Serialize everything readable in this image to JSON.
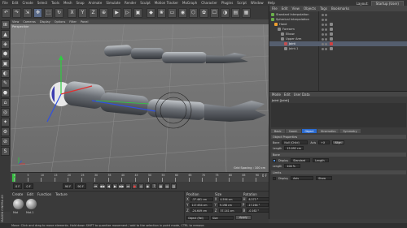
{
  "menubar": {
    "items": [
      "File",
      "Edit",
      "Create",
      "Select",
      "Tools",
      "Mesh",
      "Snap",
      "Animate",
      "Simulate",
      "Render",
      "Sculpt",
      "Motion Tracker",
      "MoGraph",
      "Character",
      "Plugins",
      "Script",
      "Window",
      "Help"
    ],
    "layout_label": "Layout:",
    "layout_value": "Startup (User)"
  },
  "toolbar": {
    "buttons": [
      "↶",
      "↷",
      "⇲",
      "✥",
      "⬚",
      "↻",
      "X",
      "Y",
      "Z",
      "⊕",
      "▶",
      "▷",
      "▣",
      "◆",
      "❀",
      "▭",
      "◉",
      "⬡",
      "✿",
      "☐",
      "◑",
      "▤",
      "▦"
    ]
  },
  "lefttoolbar": {
    "buttons": [
      "⊞",
      "▲",
      "◈",
      "⬢",
      "▣",
      "◐",
      "✎",
      "⬣",
      "⌂",
      "◎",
      "✦",
      "⚙",
      "⊘",
      "S"
    ]
  },
  "viewport": {
    "menu": [
      "View",
      "Cameras",
      "Display",
      "Options",
      "Filter",
      "Panel"
    ],
    "label": "Perspective",
    "grid_spacing": "Grid Spacing : 100 cm"
  },
  "timeline": {
    "ticks": [
      "0",
      "5",
      "10",
      "15",
      "20",
      "25",
      "30",
      "35",
      "40",
      "45",
      "50",
      "55",
      "60",
      "65",
      "70",
      "75",
      "80",
      "85",
      "90"
    ],
    "end": "0 F"
  },
  "transport": {
    "start": "0 F",
    "current": "0 F",
    "end": "90 F",
    "end2": "90 F",
    "buttons": [
      "⏮",
      "◀◀",
      "◀",
      "▶",
      "▶▶",
      "⏭",
      "●",
      "◎",
      "◉",
      "?",
      "▦",
      "▤",
      "▥"
    ]
  },
  "materials": {
    "menu": [
      "Create",
      "Edit",
      "Function",
      "Texture"
    ],
    "items": [
      "Mat",
      "Mat.1",
      "Mat.2",
      "Mat.3"
    ]
  },
  "coords": {
    "headers": [
      "Position",
      "Size",
      "Rotation"
    ],
    "rows": [
      [
        "X",
        "-37.461 cm",
        "X",
        "4.594 cm",
        "H",
        "8.373 °"
      ],
      [
        "Y",
        "117.654 cm",
        "Y",
        "9.198 cm",
        "P",
        "-17.264 °"
      ],
      [
        "Z",
        "-24.649 cm",
        "Z",
        "37.141 cm",
        "B",
        "-0.162 °"
      ]
    ],
    "mode1": "Object (Rel)",
    "mode2": "Size",
    "apply": "Apply"
  },
  "status": "Move: Click and drag to move elements. Hold down SHIFT to quantize movement / add to the selection in point mode, CTRL to remove.",
  "side_label": "MAXON CINEMA 4D",
  "objman": {
    "menu": [
      "File",
      "Edit",
      "View",
      "Objects",
      "Tags",
      "Bookmarks"
    ],
    "rows": [
      {
        "name": "Standard Interpolation",
        "indent": 0,
        "color": "#6ab04c",
        "sel": false
      },
      {
        "name": "Spherical Interpolation",
        "indent": 0,
        "color": "#6ab04c",
        "sel": false
      },
      {
        "name": "Hand",
        "indent": 1,
        "color": "#f0a030",
        "sel": false
      },
      {
        "name": "Forearm",
        "indent": 2,
        "color": "#8a8a8a",
        "sel": false
      },
      {
        "name": "Elbow",
        "indent": 3,
        "color": "#8a8a8a",
        "sel": false
      },
      {
        "name": "Upper Arm",
        "indent": 3,
        "color": "#8a8a8a",
        "sel": false
      },
      {
        "name": "Joint",
        "indent": 4,
        "color": "#c05050",
        "sel": true
      },
      {
        "name": "Joint.1",
        "indent": 4,
        "color": "#8a8a8a",
        "sel": false
      }
    ]
  },
  "attrman": {
    "menu": [
      "Mode",
      "Edit",
      "User Data"
    ],
    "title": "Joint [Joint]",
    "tabs": [
      "Basic",
      "Coord.",
      "Object",
      "Kinematics",
      "Symmetry"
    ],
    "section1": "Object Properties",
    "bone_label": "Bone",
    "bone_value": "Null (Child)",
    "axis_label": "Axis",
    "axis_value": "+X",
    "align_label": "Align",
    "length_label": "Length",
    "length_value": "15.092 cm",
    "section2": "Bone",
    "display_label": "Display",
    "display_value": "Standard",
    "display2_value": "Length",
    "length2_label": "Length",
    "length2_value": "100 %",
    "section3": "Limits",
    "disp_label": "Display",
    "disp_value": "Axis",
    "shade_value": "Show"
  }
}
